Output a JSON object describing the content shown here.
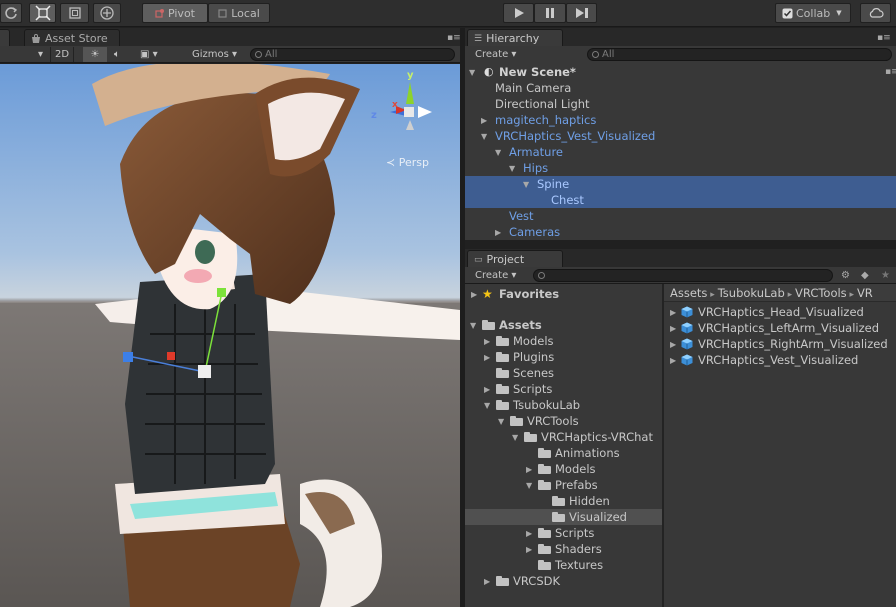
{
  "toolbar": {
    "pivot_label": "Pivot",
    "local_label": "Local",
    "collab_label": "Collab"
  },
  "scene": {
    "asset_store_tab": "Asset Store",
    "mode_2d": "2D",
    "gizmos_label": "Gizmos",
    "search_placeholder": "All",
    "persp_label": "Persp",
    "axis_x": "x",
    "axis_y": "y",
    "axis_z": "z"
  },
  "hierarchy": {
    "tab_label": "Hierarchy",
    "create_label": "Create",
    "search_placeholder": "All",
    "scene_name": "New Scene*",
    "items": [
      {
        "label": "Main Camera",
        "depth": 1,
        "arrow": "",
        "prefab": false,
        "selected": false
      },
      {
        "label": "Directional Light",
        "depth": 1,
        "arrow": "",
        "prefab": false,
        "selected": false
      },
      {
        "label": "magitech_haptics",
        "depth": 1,
        "arrow": "right",
        "prefab": true,
        "selected": false
      },
      {
        "label": "VRCHaptics_Vest_Visualized",
        "depth": 1,
        "arrow": "down",
        "prefab": true,
        "selected": false
      },
      {
        "label": "Armature",
        "depth": 2,
        "arrow": "down",
        "prefab": true,
        "selected": false
      },
      {
        "label": "Hips",
        "depth": 3,
        "arrow": "down",
        "prefab": true,
        "selected": false
      },
      {
        "label": "Spine",
        "depth": 4,
        "arrow": "down",
        "prefab": true,
        "selected": true
      },
      {
        "label": "Chest",
        "depth": 5,
        "arrow": "",
        "prefab": true,
        "selected": true
      },
      {
        "label": "Vest",
        "depth": 2,
        "arrow": "",
        "prefab": true,
        "selected": false
      },
      {
        "label": "Cameras",
        "depth": 2,
        "arrow": "right",
        "prefab": true,
        "selected": false
      }
    ]
  },
  "project": {
    "tab_label": "Project",
    "create_label": "Create",
    "favorites_label": "Favorites",
    "breadcrumb": [
      "Assets",
      "TsubokuLab",
      "VRCTools",
      "VR"
    ],
    "tree": [
      {
        "label": "Assets",
        "depth": 0,
        "arrow": "down",
        "bold": true,
        "selected": false
      },
      {
        "label": "Models",
        "depth": 1,
        "arrow": "right",
        "bold": false,
        "selected": false
      },
      {
        "label": "Plugins",
        "depth": 1,
        "arrow": "right",
        "bold": false,
        "selected": false
      },
      {
        "label": "Scenes",
        "depth": 1,
        "arrow": "",
        "bold": false,
        "selected": false
      },
      {
        "label": "Scripts",
        "depth": 1,
        "arrow": "right",
        "bold": false,
        "selected": false
      },
      {
        "label": "TsubokuLab",
        "depth": 1,
        "arrow": "down",
        "bold": false,
        "selected": false
      },
      {
        "label": "VRCTools",
        "depth": 2,
        "arrow": "down",
        "bold": false,
        "selected": false
      },
      {
        "label": "VRCHaptics-VRChat",
        "depth": 3,
        "arrow": "down",
        "bold": false,
        "selected": false
      },
      {
        "label": "Animations",
        "depth": 4,
        "arrow": "",
        "bold": false,
        "selected": false
      },
      {
        "label": "Models",
        "depth": 4,
        "arrow": "right",
        "bold": false,
        "selected": false
      },
      {
        "label": "Prefabs",
        "depth": 4,
        "arrow": "down",
        "bold": false,
        "selected": false
      },
      {
        "label": "Hidden",
        "depth": 5,
        "arrow": "",
        "bold": false,
        "selected": false
      },
      {
        "label": "Visualized",
        "depth": 5,
        "arrow": "",
        "bold": false,
        "selected": true
      },
      {
        "label": "Scripts",
        "depth": 4,
        "arrow": "right",
        "bold": false,
        "selected": false
      },
      {
        "label": "Shaders",
        "depth": 4,
        "arrow": "right",
        "bold": false,
        "selected": false
      },
      {
        "label": "Textures",
        "depth": 4,
        "arrow": "",
        "bold": false,
        "selected": false
      },
      {
        "label": "VRCSDK",
        "depth": 1,
        "arrow": "right",
        "bold": false,
        "selected": false
      }
    ],
    "assets": [
      "VRCHaptics_Head_Visualized",
      "VRCHaptics_LeftArm_Visualized",
      "VRCHaptics_RightArm_Visualized",
      "VRCHaptics_Vest_Visualized"
    ]
  }
}
